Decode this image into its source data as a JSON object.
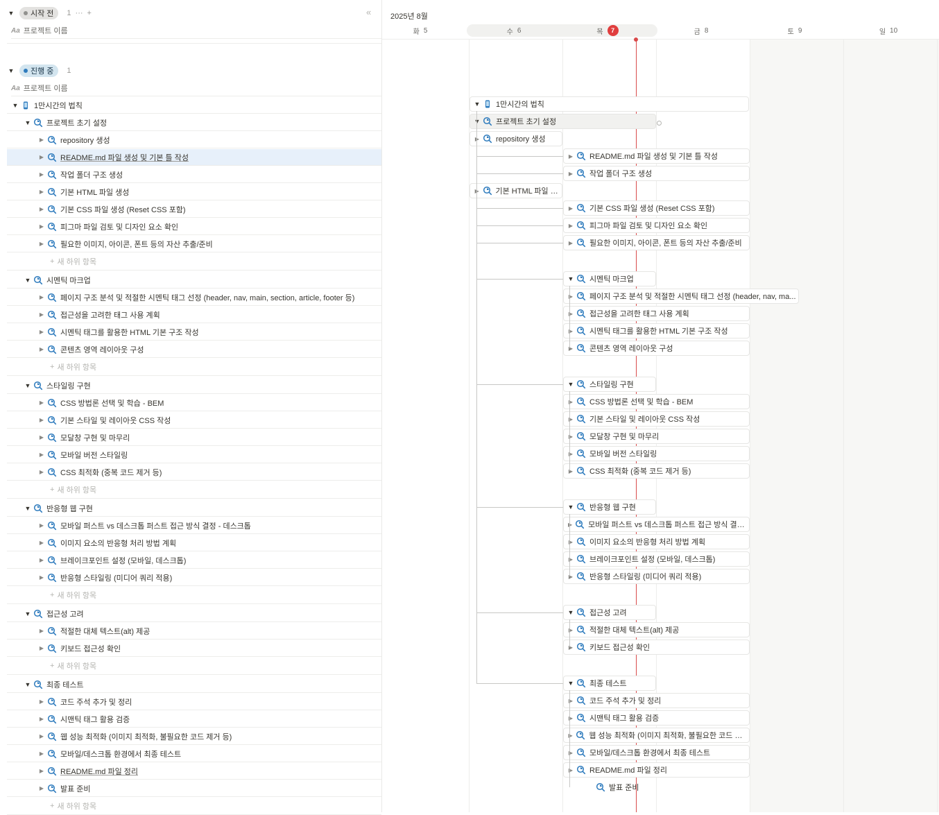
{
  "groups": {
    "not_started": {
      "label": "시작 전",
      "count": "1",
      "more": "···",
      "add": "+",
      "dot_color": "#91918e"
    },
    "in_progress": {
      "label": "진행 중",
      "count": "1",
      "dot_color": "#2e7bbd"
    }
  },
  "property_header": "프로젝트 이름",
  "collapse_icon": "«",
  "new_subitem": "새 하위 항목",
  "project": "1만시간의 법칙",
  "sections": [
    {
      "title": "프로젝트 초기 설정",
      "items": [
        "repository 생성",
        "README.md 파일 생성 및 기본 틀 작성",
        "작업 폴더 구조 생성",
        "기본 HTML 파일 생성",
        "기본 CSS 파일 생성 (Reset CSS 포함)",
        "피그마 파일 검토 및 디자인 요소 확인",
        "필요한 이미지, 아이콘, 폰트 등의 자산 추출/준비"
      ]
    },
    {
      "title": "시멘틱 마크업",
      "items": [
        "페이지 구조 분석 및 적절한 시멘틱 태그 선정 (header, nav, main, section, article, footer 등)",
        "접근성을 고려한 태그 사용 계획",
        "시멘틱 태그를 활용한 HTML 기본 구조 작성",
        "콘텐츠 영역 레이아웃 구성"
      ]
    },
    {
      "title": "스타일링 구현",
      "items": [
        "CSS 방법론 선택 및 학습 - BEM",
        "기본 스타일 및 레이아웃 CSS 작성",
        "모달창 구현 및 마무리",
        "모바일 버전 스타일링",
        "CSS 최적화 (중복 코드 제거 등)"
      ]
    },
    {
      "title": "반응형 웹 구현",
      "items": [
        "모바일 퍼스트 vs 데스크톱 퍼스트 접근 방식 결정 - 데스크톱",
        "이미지 요소의 반응형 처리 방법 계획",
        "브레이크포인트 설정 (모바일, 데스크톱)",
        "반응형 스타일링 (미디어 쿼리 적용)"
      ]
    },
    {
      "title": "접근성 고려",
      "items": [
        "적절한 대체 텍스트(alt) 제공",
        "키보드 접근성 확인"
      ]
    },
    {
      "title": "최종 테스트",
      "items": [
        "코드 주석 추가 및 정리",
        "시맨틱 태그 활용 검증",
        "웹 성능 최적화 (이미지 최적화, 불필요한 코드 제거 등)",
        "모바일/데스크톱 환경에서 최종 테스트",
        "README.md 파일 정리",
        "발표 준비"
      ]
    }
  ],
  "timeline": {
    "month": "2025년 8월",
    "days": [
      {
        "dow": "화",
        "num": "5"
      },
      {
        "dow": "수",
        "num": "6"
      },
      {
        "dow": "목",
        "num": "7",
        "today": true
      },
      {
        "dow": "금",
        "num": "8"
      },
      {
        "dow": "토",
        "num": "9"
      },
      {
        "dow": "일",
        "num": "10"
      }
    ],
    "bar_overrides": {
      "페이지 구조 분석 및 적절한 시멘틱 태그 선정 (header, nav, main, section, article, footer 등)": "페이지 구조 분석 및 적절한 시멘틱 태그 선정 (header, nav, ma..."
    }
  },
  "colors": {
    "today": "#e03e3e",
    "icon": "#2e7bbd",
    "highlight": "#e7f0fa"
  }
}
